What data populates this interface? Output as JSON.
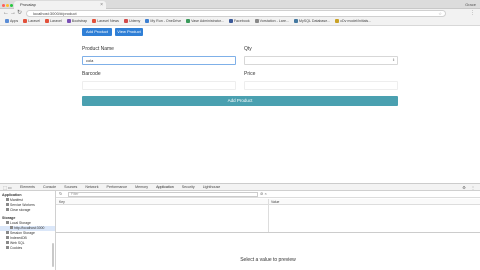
{
  "browser": {
    "tab_title": "Provalap",
    "account": "Grace",
    "url": "localhost:3000/#/product",
    "bookmarks": [
      {
        "label": "Apps",
        "color": "#5b8dd6"
      },
      {
        "label": "Laravel",
        "color": "#e2513b"
      },
      {
        "label": "Laravel",
        "color": "#e2513b"
      },
      {
        "label": "Bootstrap",
        "color": "#7a4fb5"
      },
      {
        "label": "Laravel News",
        "color": "#e2513b"
      },
      {
        "label": "Udemy",
        "color": "#d14a4a"
      },
      {
        "label": "My Run - OneDrive",
        "color": "#3c7fd1"
      },
      {
        "label": "Vase Administrator...",
        "color": "#3a9a5b"
      },
      {
        "label": "Facebook",
        "color": "#3b5998"
      },
      {
        "label": "Vorstation - Lare...",
        "color": "#888888"
      },
      {
        "label": "MySQL Database...",
        "color": "#4479a1"
      },
      {
        "label": "cDv model/initials...",
        "color": "#c9a227"
      }
    ]
  },
  "toolbar_buttons": {
    "add_product": "Add Product",
    "view_product": "View Product"
  },
  "form": {
    "product_name_label": "Product Name",
    "product_name_value": "cola",
    "qty_label": "Qty",
    "qty_value": "",
    "barcode_label": "Barcode",
    "barcode_value": "",
    "price_label": "Price",
    "price_value": "",
    "submit_label": "Add Product"
  },
  "devtools": {
    "tabs": [
      "Elements",
      "Console",
      "Sources",
      "Network",
      "Performance",
      "Memory",
      "Application",
      "Security",
      "Lighthouse"
    ],
    "active_tab": "Application",
    "sidebar": {
      "application_title": "Application",
      "application_items": [
        "Manifest",
        "Service Workers",
        "Clear storage"
      ],
      "storage_title": "Storage",
      "storage_items": [
        {
          "label": "Local Storage",
          "sub": false,
          "hl": false
        },
        {
          "label": "http://localhost:3000",
          "sub": true,
          "hl": true
        },
        {
          "label": "Session Storage",
          "sub": false,
          "hl": false
        },
        {
          "label": "IndexedDB",
          "sub": false,
          "hl": false
        },
        {
          "label": "Web SQL",
          "sub": false,
          "hl": false
        },
        {
          "label": "Cookies",
          "sub": false,
          "hl": false
        }
      ]
    },
    "filter_placeholder": "Filter",
    "columns": {
      "key": "Key",
      "value": "Value"
    },
    "preview_message": "Select a value to preview"
  }
}
